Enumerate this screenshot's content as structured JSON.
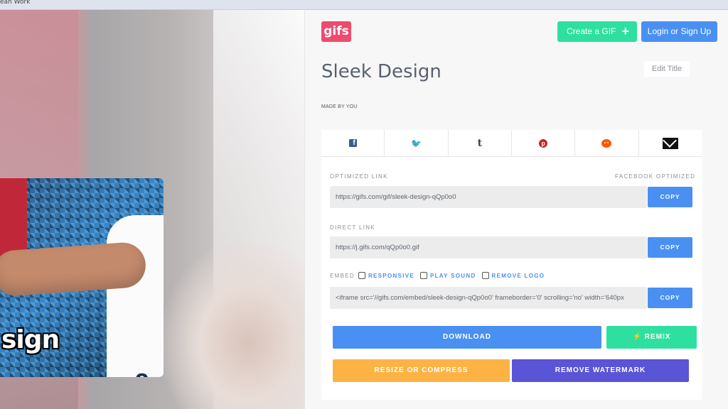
{
  "window": {
    "title_fragment": "ean Work"
  },
  "gif_preview": {
    "caption": "sign",
    "shirt_text": "o"
  },
  "header": {
    "logo_text": "gifs",
    "create_label": "Create a GIF",
    "create_icon": "+",
    "login_label": "Login or Sign Up"
  },
  "gif_info": {
    "title": "Sleek Design",
    "edit_title_label": "Edit Title",
    "made_by": "MADE BY YOU"
  },
  "share": {
    "icons": [
      "facebook-icon",
      "twitter-icon",
      "tumblr-icon",
      "pinterest-icon",
      "reddit-icon",
      "email-icon"
    ],
    "fb_glyph": "f",
    "tw_glyph": "🐦",
    "tm_glyph": "t",
    "pi_glyph": "p"
  },
  "links": {
    "optimized_label": "OPTIMIZED LINK",
    "facebook_optimized_label": "FACEBOOK OPTIMIZED",
    "optimized_url": "https://gifs.com/gif/sleek-design-qQp0o0",
    "direct_label": "DIRECT LINK",
    "direct_url": "https://j.gifs.com/qQp0o0.gif",
    "embed_label": "EMBED",
    "responsive_label": "RESPONSIVE",
    "play_sound_label": "PLAY SOUND",
    "remove_logo_label": "REMOVE LOGO",
    "embed_code": "<iframe src='//gifs.com/embed/sleek-design-qQp0o0' frameborder='0' scrolling='no' width='640px",
    "copy_label": "COPY"
  },
  "actions": {
    "download_label": "DOWNLOAD",
    "remix_label": "REMIX",
    "remix_icon": "⚡",
    "resize_label": "RESIZE OR COMPRESS",
    "watermark_label": "REMOVE WATERMARK"
  },
  "colors": {
    "brand_pink": "#ef4b6e",
    "accent_green": "#2ee0a0",
    "accent_blue": "#4a90f2",
    "accent_orange": "#fcb344",
    "accent_purple": "#5a54d6"
  }
}
